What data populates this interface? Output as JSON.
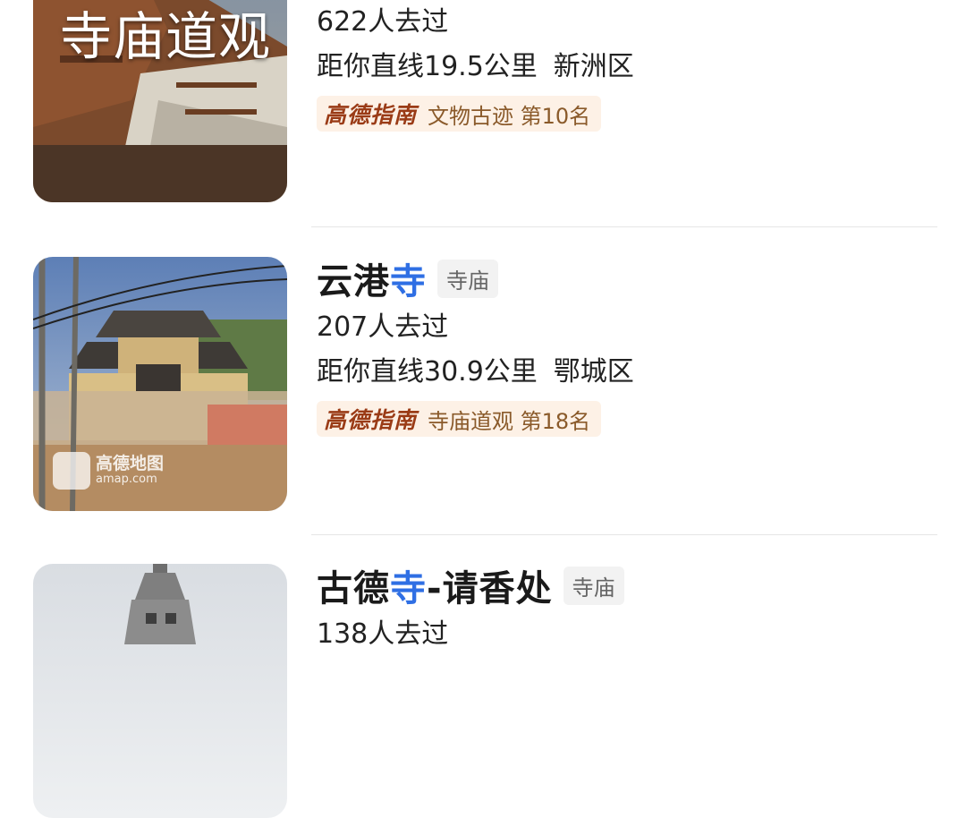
{
  "results": [
    {
      "visitors": "622人去过",
      "distance": "距你直线19.5公里",
      "district": "新洲区",
      "guide_brand": "高德指南",
      "guide_rank": "文物古迹  第10名",
      "image_text": "寺庙道观"
    },
    {
      "title_pre": "云港",
      "title_hl": "寺",
      "title_post": "",
      "category": "寺庙",
      "visitors": "207人去过",
      "distance": "距你直线30.9公里",
      "district": "鄂城区",
      "guide_brand": "高德指南",
      "guide_rank": "寺庙道观  第18名",
      "watermark_line1": "高德地图",
      "watermark_line2": "amap.com"
    },
    {
      "title_pre": "古德",
      "title_hl": "寺",
      "title_post": "-请香处",
      "category": "寺庙",
      "visitors": "138人去过"
    }
  ],
  "colors": {
    "highlight": "#2f6fe4",
    "guide_bg": "#fdf1e6",
    "guide_brand": "#9a3b16"
  }
}
